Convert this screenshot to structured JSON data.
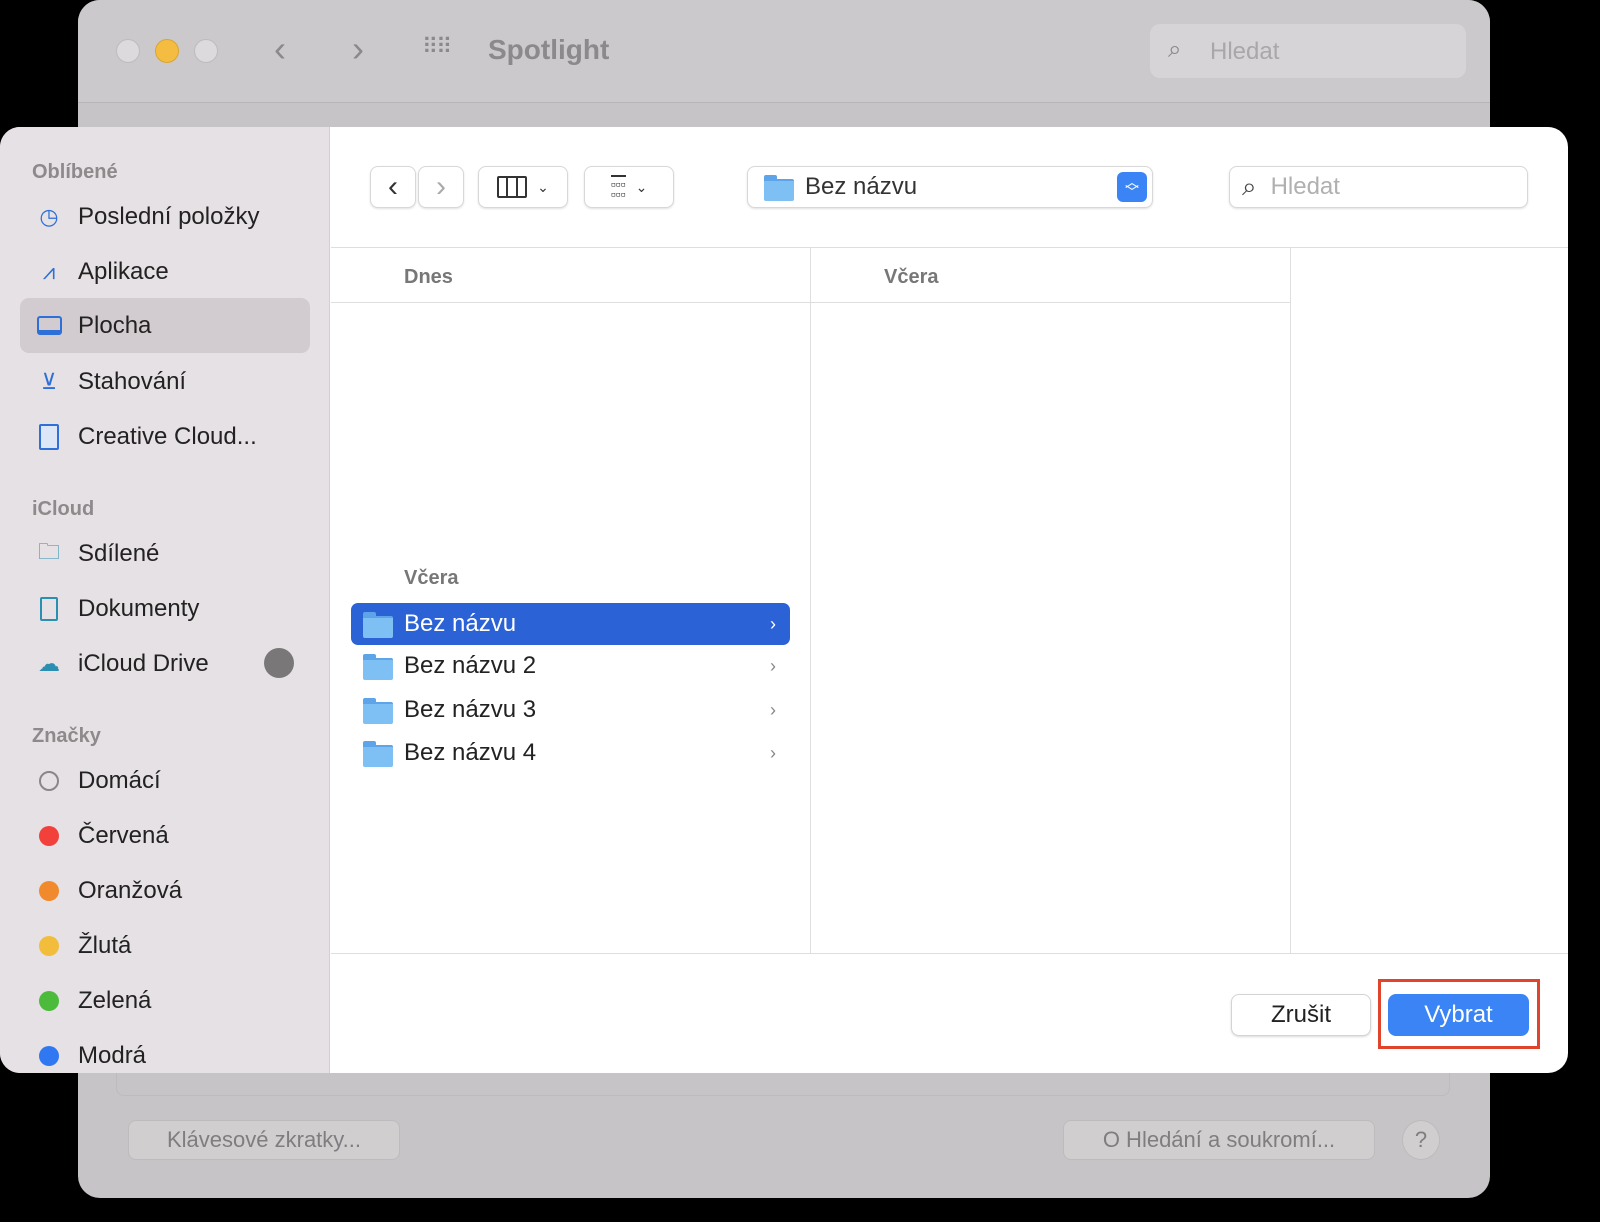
{
  "background_window": {
    "title": "Spotlight",
    "search_placeholder": "Hledat",
    "shortcuts_button": "Klávesové zkratky...",
    "privacy_button": "O Hledání a soukromí...",
    "help_button": "?"
  },
  "dialog": {
    "toolbar": {
      "back": "‹",
      "forward": "›",
      "location": "Bez názvu",
      "search_placeholder": "Hledat"
    },
    "sidebar": {
      "sections": [
        {
          "title": "Oblíbené",
          "items": [
            {
              "label": "Poslední položky",
              "icon": "clock-icon"
            },
            {
              "label": "Aplikace",
              "icon": "applications-icon"
            },
            {
              "label": "Plocha",
              "icon": "desktop-icon",
              "selected": true
            },
            {
              "label": "Stahování",
              "icon": "download-icon"
            },
            {
              "label": "Creative Cloud...",
              "icon": "document-icon"
            }
          ]
        },
        {
          "title": "iCloud",
          "items": [
            {
              "label": "Sdílené",
              "icon": "shared-folder-icon"
            },
            {
              "label": "Dokumenty",
              "icon": "document-icon"
            },
            {
              "label": "iCloud Drive",
              "icon": "cloud-icon"
            }
          ]
        },
        {
          "title": "Značky",
          "items": [
            {
              "label": "Domácí",
              "color": "#ffffff"
            },
            {
              "label": "Červená",
              "color": "#f2403a"
            },
            {
              "label": "Oranžová",
              "color": "#f08a2c"
            },
            {
              "label": "Žlutá",
              "color": "#f2bd3a"
            },
            {
              "label": "Zelená",
              "color": "#4cbb3c"
            },
            {
              "label": "Modrá",
              "color": "#2f78f2"
            }
          ]
        }
      ]
    },
    "columns": [
      {
        "header_today": "Dnes",
        "header_yesterday": "Včera",
        "items": [
          "Bez názvu",
          "Bez názvu 2",
          "Bez názvu 3",
          "Bez názvu 4"
        ]
      },
      {
        "header": "Včera"
      }
    ],
    "cancel_button": "Zrušit",
    "choose_button": "Vybrat",
    "accent": "#3a84f5",
    "highlight": "#e0442b"
  }
}
